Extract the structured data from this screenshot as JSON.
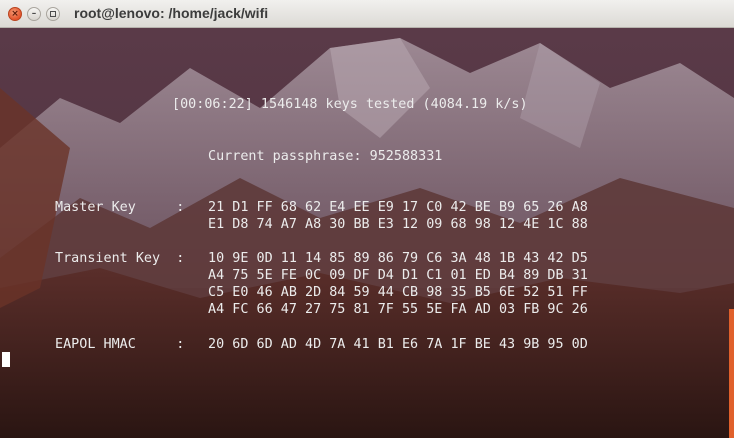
{
  "window": {
    "title": "root@lenovo: /home/jack/wifi",
    "buttons": {
      "close": "×",
      "minimize": "–"
    }
  },
  "terminal": {
    "progress": "[00:06:22] 1546148 keys tested (4084.19 k/s)",
    "passphrase": "Current passphrase: 952588331",
    "master_key": {
      "label": "Master Key     : ",
      "rows": [
        "21 D1 FF 68 62 E4 EE E9 17 C0 42 BE B9 65 26 A8",
        "E1 D8 74 A7 A8 30 BB E3 12 09 68 98 12 4E 1C 88"
      ]
    },
    "transient_key": {
      "label": "Transient Key  : ",
      "rows": [
        "10 9E 0D 11 14 85 89 86 79 C6 3A 48 1B 43 42 D5",
        "A4 75 5E FE 0C 09 DF D4 D1 C1 01 ED B4 89 DB 31",
        "C5 E0 46 AB 2D 84 59 44 CB 98 35 B5 6E 52 51 FF",
        "A4 FC 66 47 27 75 81 7F 55 5E FA AD 03 FB 9C 26"
      ]
    },
    "eapol_hmac": {
      "label": "EAPOL HMAC     : ",
      "value": "20 6D 6D AD 4D 7A 41 B1 E6 7A 1F BE 43 9B 95 0D"
    }
  },
  "colors": {
    "terminal_text": "#ececec",
    "scrollbar_accent": "#e0602b",
    "close_button": "#e2542c"
  }
}
